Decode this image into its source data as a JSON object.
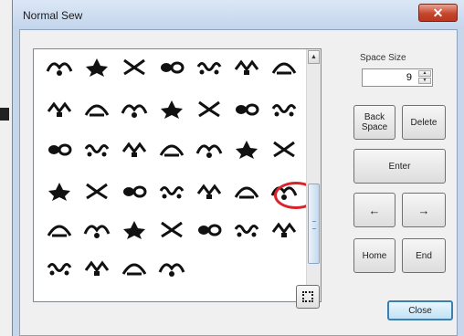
{
  "window": {
    "title": "Normal Sew",
    "close_glyph": "✕"
  },
  "glyph_panel": {
    "rows": [
      [
        "glyph-1",
        "glyph-2",
        "glyph-3",
        "glyph-4",
        "glyph-5",
        "glyph-6",
        "glyph-7"
      ],
      [
        "glyph-8",
        "glyph-9",
        "glyph-10",
        "glyph-11",
        "glyph-12",
        "glyph-13",
        "glyph-14"
      ],
      [
        "glyph-15",
        "glyph-16",
        "glyph-17",
        "glyph-18",
        "glyph-19",
        "glyph-20",
        "glyph-21"
      ],
      [
        "glyph-22",
        "glyph-23",
        "glyph-24",
        "glyph-25",
        "glyph-26",
        "glyph-27",
        "glyph-28"
      ],
      [
        "glyph-29",
        "glyph-30",
        "glyph-31",
        "glyph-32",
        "glyph-33",
        "glyph-34",
        "glyph-35"
      ],
      [
        "glyph-36",
        "glyph-37",
        "glyph-38",
        "glyph-39"
      ]
    ],
    "highlighted_glyph": "glyph-28",
    "highlight_color": "#d8232a",
    "scroll_up_glyph": "▲",
    "scroll_down_glyph": "▼"
  },
  "space_size": {
    "label": "Space Size",
    "value": "9",
    "up_glyph": "▲",
    "down_glyph": "▼"
  },
  "buttons": {
    "back_space": "Back Space",
    "delete": "Delete",
    "enter": "Enter",
    "left": "←",
    "right": "→",
    "home": "Home",
    "end": "End",
    "close": "Close"
  },
  "colors": {
    "title_bar": "#c3d5ec",
    "close_button": "#c7452c",
    "primary_button_border": "#3c7fb1"
  }
}
